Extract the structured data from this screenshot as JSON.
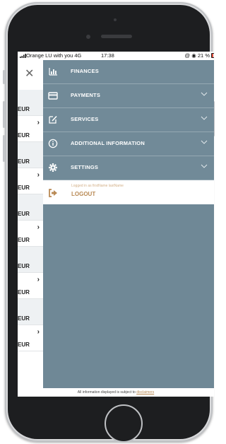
{
  "status_bar": {
    "carrier": "Orange LU with you  4G",
    "time": "17:38",
    "battery": "21 %"
  },
  "background_list": {
    "rows": [
      {
        "amount": "EUR",
        "chevron": false
      },
      {
        "amount": "EUR",
        "chevron": true
      },
      {
        "amount": "EUR",
        "chevron": false
      },
      {
        "amount": "EUR",
        "chevron": true
      },
      {
        "amount": "EUR",
        "chevron": false
      },
      {
        "amount": "EUR",
        "chevron": true
      },
      {
        "amount": "EUR",
        "chevron": false
      },
      {
        "amount": "EUR",
        "chevron": true
      },
      {
        "amount": "EUR",
        "chevron": false
      },
      {
        "amount": "EUR",
        "chevron": true
      }
    ]
  },
  "menu": {
    "items": [
      {
        "label": "FINANCES",
        "icon": "bar-chart-icon",
        "expandable": false
      },
      {
        "label": "PAYMENTS",
        "icon": "credit-card-icon",
        "expandable": true
      },
      {
        "label": "SERVICES",
        "icon": "edit-icon",
        "expandable": true
      },
      {
        "label": "ADDITIONAL INFORMATION",
        "icon": "info-icon",
        "expandable": true
      },
      {
        "label": "SETTINGS",
        "icon": "gear-icon",
        "expandable": true
      }
    ],
    "logout": {
      "subtitle": "Logged in as firstName lastName",
      "label": "LOGOUT",
      "icon": "logout-icon"
    }
  },
  "footer": {
    "text": "All information displayed is subject to",
    "link": "disclaimers"
  },
  "colors": {
    "menu_background": "#718a98",
    "accent": "#b98a55",
    "separator": "#95a8b3"
  }
}
